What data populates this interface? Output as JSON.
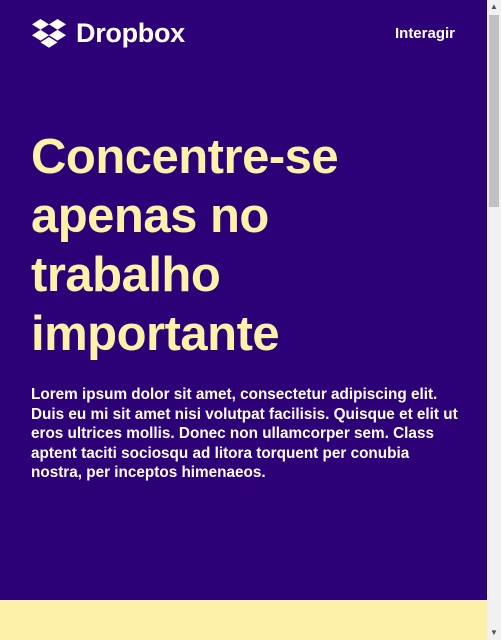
{
  "header": {
    "brand_name": "Dropbox",
    "logo_icon": "dropbox-logo-icon",
    "nav_link": "Interagir"
  },
  "hero": {
    "title": "Concentre-se apenas no trabalho importante",
    "body": "Lorem ipsum dolor sit amet, consectetur adipiscing elit. Duis eu mi sit amet nisi volutpat facilisis. Quisque et elit ut eros ultrices mollis. Donec non ullamcorper sem. Class aptent taciti sociosqu ad litora torquent per conubia nostra, per inceptos himenaeos."
  },
  "colors": {
    "background": "#2e0077",
    "title": "#fff1a8",
    "band": "#fff0a8",
    "text": "#ffffff"
  },
  "scrollbar": {
    "up_icon": "scroll-up-arrow-icon",
    "down_icon": "scroll-down-arrow-icon"
  }
}
